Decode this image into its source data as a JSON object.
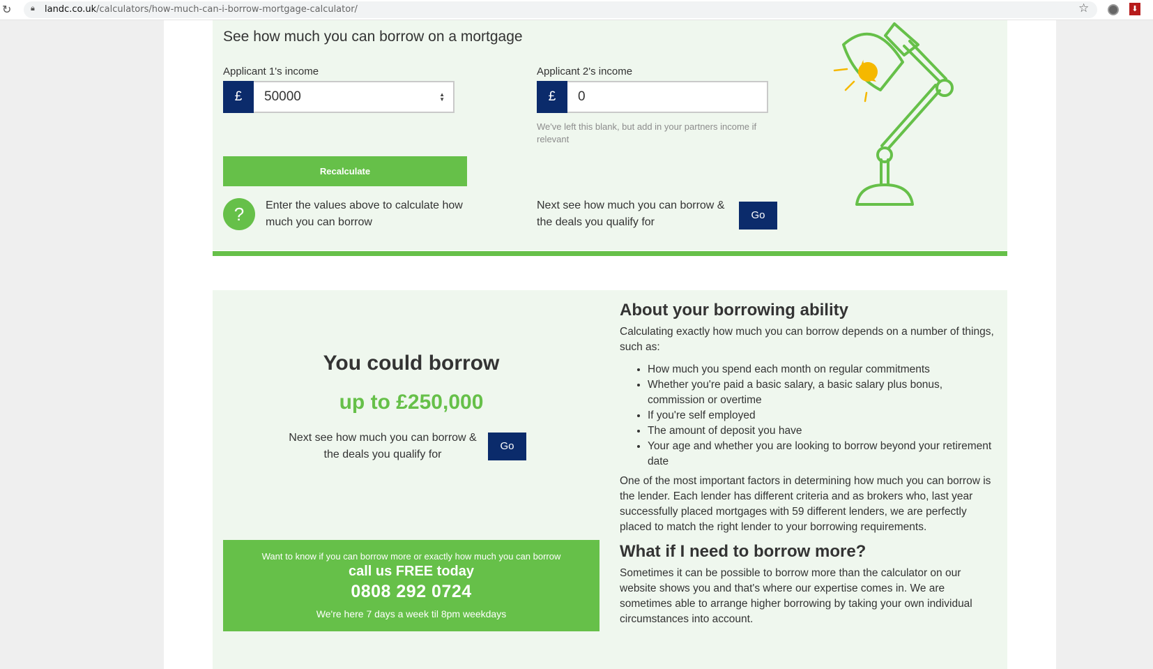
{
  "browser": {
    "url_host": "landc.co.uk",
    "url_path": "/calculators/how-much-can-i-borrow-mortgage-calculator/"
  },
  "calculator": {
    "title": "See how much you can borrow on a mortgage",
    "applicant1_label": "Applicant 1's income",
    "applicant1_value": "50000",
    "applicant2_label": "Applicant 2's income",
    "applicant2_value": "0",
    "currency_symbol": "£",
    "applicant2_hint": "We've left this blank, but add in your partners income if relevant",
    "recalculate_label": "Recalculate",
    "help_icon": "?",
    "help_text": "Enter the values above to calculate how much you can borrow",
    "next_text": "Next see how much you can borrow & the deals you qualify for",
    "go_label": "Go"
  },
  "result": {
    "heading": "You could borrow",
    "amount": "up to £250,000",
    "next_text": "Next see how much you can borrow & the deals you qualify for",
    "go_label": "Go",
    "cta": {
      "line1": "Want to know if you can borrow more or exactly how much you can borrow",
      "line2": "call us FREE today",
      "phone": "0808 292 0724",
      "line4": "We're here 7 days a week til 8pm weekdays"
    }
  },
  "about": {
    "heading": "About your borrowing ability",
    "intro": "Calculating exactly how much you can borrow depends on a number of things, such as:",
    "bullets": [
      "How much you spend each month on regular commitments",
      "Whether you're paid a basic salary, a basic salary plus bonus, commission or overtime",
      "If you're self employed",
      "The amount of deposit you have",
      "Your age and whether you are looking to borrow beyond your retirement date"
    ],
    "paragraph": "One of the most important factors in determining how much you can borrow is the lender. Each lender has different criteria and as brokers who, last year successfully placed mortgages with 59 different lenders, we are perfectly placed to match the right lender to your borrowing requirements.",
    "heading2": "What if I need to borrow more?",
    "paragraph2": "Sometimes it can be possible to borrow more than the calculator on our website shows you and that's where our expertise comes in. We are sometimes able to arrange higher borrowing by taking your own individual circumstances into account."
  },
  "colors": {
    "brand_green": "#66c049",
    "brand_navy": "#0b2b6b",
    "panel_bg": "#eff7ee",
    "lamp_bulb": "#f5b800"
  },
  "icons": [
    "reload-icon",
    "lock-icon",
    "star-icon",
    "extension-icon",
    "pdf-icon",
    "desk-lamp-illustration"
  ]
}
